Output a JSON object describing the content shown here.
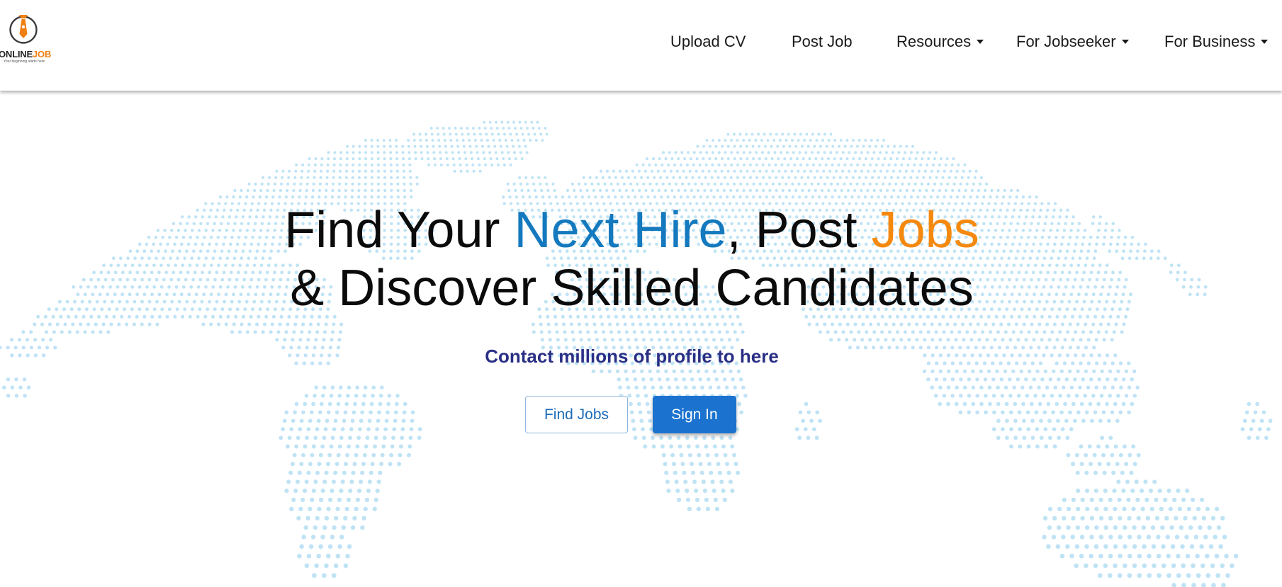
{
  "brand": {
    "name_part1": "ONLINE",
    "name_part2": "JOB",
    "tagline": "Your beginning starts here",
    "colors": {
      "orange": "#f07f12",
      "dark": "#333333"
    }
  },
  "nav": {
    "items": [
      {
        "label": "Upload CV",
        "dropdown": false
      },
      {
        "label": "Post Job",
        "dropdown": false
      },
      {
        "label": "Resources",
        "dropdown": true
      },
      {
        "label": "For Jobseeker",
        "dropdown": true
      },
      {
        "label": "For Business",
        "dropdown": true
      }
    ]
  },
  "hero": {
    "title": {
      "part1": "Find Your ",
      "highlight1": "Next Hire",
      "part2": ", Post ",
      "highlight2": "Jobs",
      "line2": "& Discover Skilled Candidates"
    },
    "subtitle": "Contact millions of profile to here",
    "buttons": {
      "find_jobs": "Find Jobs",
      "sign_in": "Sign In"
    },
    "colors": {
      "title": "#0b0b0b",
      "highlight_blue": "#1479be",
      "highlight_orange": "#f5890f",
      "subtitle": "#2a2f85",
      "primary_button": "#1b73cf",
      "map_dots": "#bfe3f4"
    },
    "background": "world-map-dots"
  }
}
